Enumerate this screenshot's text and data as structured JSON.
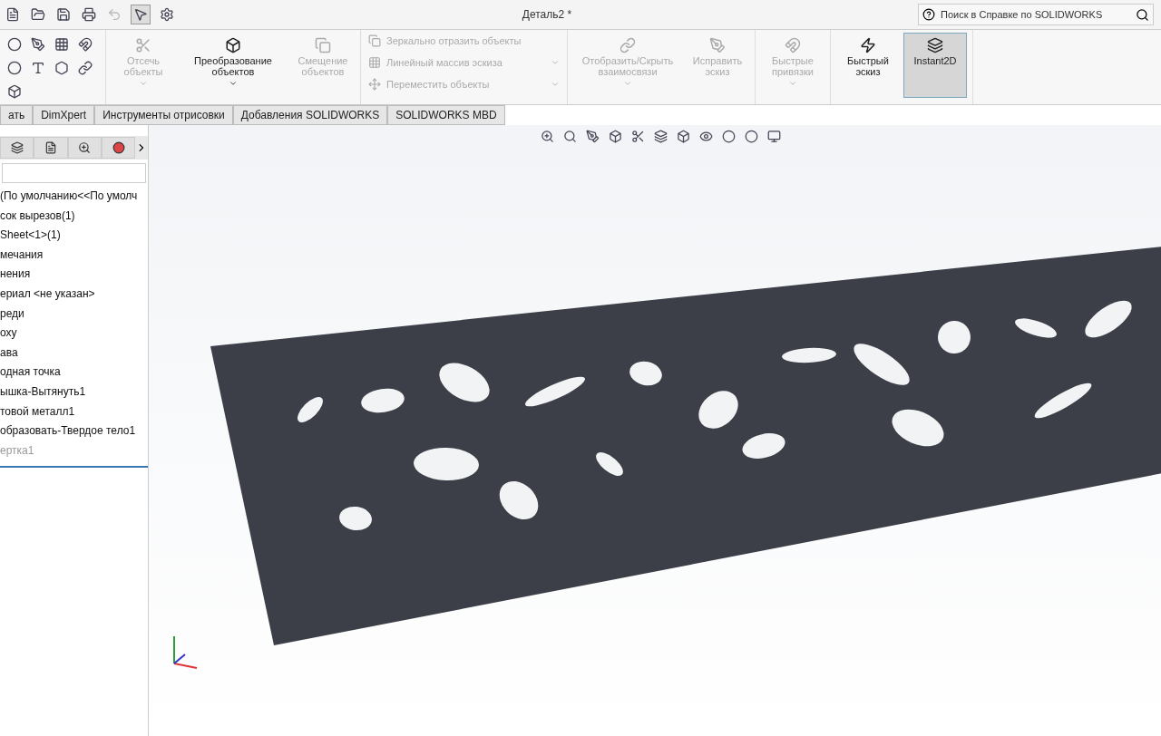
{
  "window": {
    "title": "Деталь2 *"
  },
  "help_search": {
    "placeholder": "Поиск в Справке по SOLIDWORKS"
  },
  "ribbon": {
    "groups": [
      {
        "kind": "large",
        "buttons": [
          {
            "label": "Отсечь объекты",
            "disabled": true,
            "pressed": false,
            "dropdown": true
          },
          {
            "label": "Преобразование объектов",
            "disabled": false,
            "pressed": false,
            "dropdown": true
          },
          {
            "label": "Смещение объектов",
            "disabled": true,
            "pressed": false,
            "dropdown": false
          }
        ]
      },
      {
        "kind": "list",
        "buttons": [
          {
            "label": "Зеркально отразить объекты",
            "disabled": true,
            "dropdown": false
          },
          {
            "label": "Линейный массив эскиза",
            "disabled": true,
            "dropdown": true
          },
          {
            "label": "Переместить объекты",
            "disabled": true,
            "dropdown": true
          }
        ]
      },
      {
        "kind": "large",
        "buttons": [
          {
            "label": "Отобразить/Скрыть взаимосвязи",
            "disabled": true,
            "pressed": false,
            "dropdown": true
          },
          {
            "label": "Исправить эскиз",
            "disabled": true,
            "pressed": false,
            "dropdown": false
          }
        ]
      },
      {
        "kind": "large",
        "buttons": [
          {
            "label": "Быстрые привязки",
            "disabled": true,
            "pressed": false,
            "dropdown": true
          }
        ]
      },
      {
        "kind": "large",
        "buttons": [
          {
            "label": "Быстрый эскиз",
            "disabled": false,
            "pressed": false,
            "dropdown": false
          },
          {
            "label": "Instant2D",
            "disabled": false,
            "pressed": true,
            "dropdown": false
          }
        ]
      }
    ]
  },
  "command_tabs": [
    {
      "label": "ать"
    },
    {
      "label": "DimXpert"
    },
    {
      "label": "Инструменты отрисовки"
    },
    {
      "label": "Добавления SOLIDWORKS"
    },
    {
      "label": "SOLIDWORKS MBD"
    }
  ],
  "feature_tree": {
    "items": [
      {
        "label": "(По умолчанию<<По умолч",
        "suppressed": false
      },
      {
        "label": "сок вырезов(1)",
        "suppressed": false
      },
      {
        "label": "Sheet<1>(1)",
        "suppressed": false
      },
      {
        "label": "мечания",
        "suppressed": false
      },
      {
        "label": "нения",
        "suppressed": false
      },
      {
        "label": "ериал <не указан>",
        "suppressed": false
      },
      {
        "label": "реди",
        "suppressed": false
      },
      {
        "label": "оху",
        "suppressed": false
      },
      {
        "label": "ава",
        "suppressed": false
      },
      {
        "label": "одная точка",
        "suppressed": false
      },
      {
        "label": "ышка-Вытянуть1",
        "suppressed": false
      },
      {
        "label": "товой металл1",
        "suppressed": false
      },
      {
        "label": "образовать-Твердое тело1",
        "suppressed": false
      },
      {
        "label": "ертка1",
        "suppressed": true
      }
    ]
  }
}
